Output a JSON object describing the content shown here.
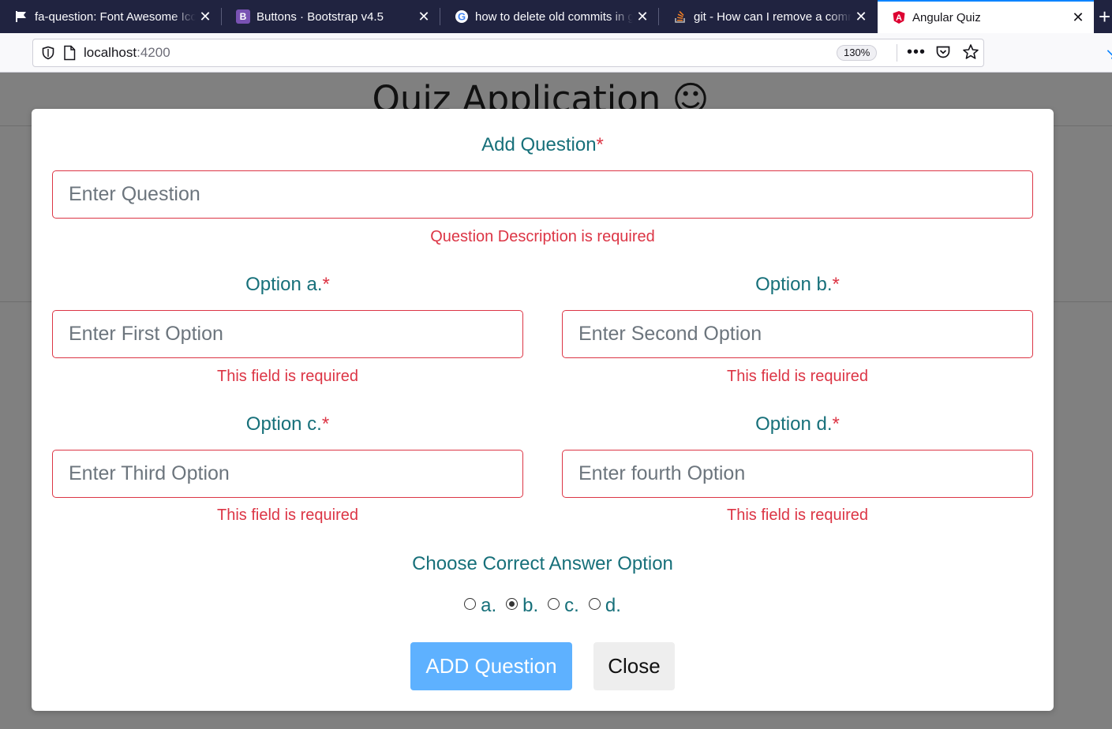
{
  "browser": {
    "tabs": [
      {
        "title": "fa-question: Font Awesome Icons",
        "icon": "flag-icon"
      },
      {
        "title": "Buttons · Bootstrap v4.5",
        "icon": "bootstrap-icon"
      },
      {
        "title": "how to delete old commits in git",
        "icon": "google-icon"
      },
      {
        "title": "git - How can I remove a commit",
        "icon": "stackoverflow-icon"
      },
      {
        "title": "Angular Quiz",
        "icon": "angular-icon"
      }
    ],
    "url_host": "localhost",
    "url_port": ":4200",
    "zoom": "130%"
  },
  "page": {
    "title": "Quiz Application ☺"
  },
  "modal": {
    "question_label": "Add Question",
    "required_mark": "*",
    "question_placeholder": "Enter Question",
    "question_error": "Question Description is required",
    "options": [
      {
        "label": "Option a.",
        "placeholder": "Enter First Option",
        "error": "This field is required"
      },
      {
        "label": "Option b.",
        "placeholder": "Enter Second Option",
        "error": "This field is required"
      },
      {
        "label": "Option c.",
        "placeholder": "Enter Third Option",
        "error": "This field is required"
      },
      {
        "label": "Option d.",
        "placeholder": "Enter fourth Option",
        "error": "This field is required"
      }
    ],
    "correct_label": "Choose Correct Answer Option",
    "answer_choices": [
      "a.",
      "b.",
      "c.",
      "d."
    ],
    "selected_answer": "b.",
    "add_button": "ADD Question",
    "close_button": "Close"
  },
  "colors": {
    "label": "#17707a",
    "error": "#dc3545",
    "add_button": "#5eb1ff",
    "tabbar": "#202340"
  }
}
